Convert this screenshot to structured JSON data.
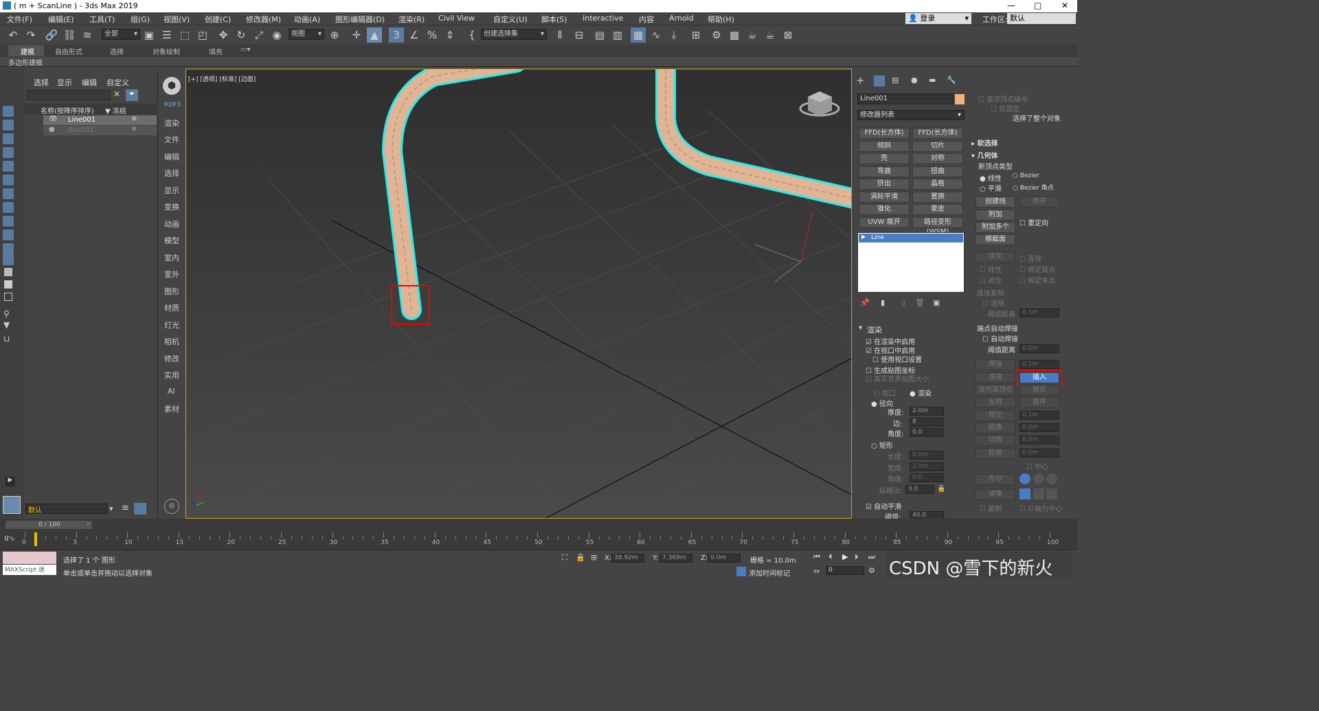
{
  "window": {
    "title": "( m + ScanLine ) - 3ds Max 2019",
    "controls": [
      "—",
      "□",
      "✕"
    ]
  },
  "menu": [
    "文件(F)",
    "编辑(E)",
    "工具(T)",
    "组(G)",
    "视图(V)",
    "创建(C)",
    "修改器(M)",
    "动画(A)",
    "图形编辑器(D)",
    "渲染(R)",
    "Civil View",
    "自定义(U)",
    "脚本(S)",
    "Interactive",
    "内容",
    "Arnold",
    "帮助(H)"
  ],
  "account": {
    "login": "登录",
    "workspace_label": "工作区:",
    "workspace_value": "默认"
  },
  "toolbar": {
    "selection_filter": "全部",
    "ref_coord": "视图",
    "named_selection": "创建选择集"
  },
  "ribbon": {
    "tabs": [
      "建模",
      "自由形式",
      "选择",
      "对象绘制",
      "填充"
    ],
    "active_tab": "建模",
    "sub": "多边形建模"
  },
  "scene_explorer": {
    "menu": [
      "选择",
      "显示",
      "编辑",
      "自定义"
    ],
    "column_name": "名称(按降序排序)",
    "column_freeze": "▼ 冻结",
    "rows": [
      {
        "name": "Line001",
        "selected": true
      },
      {
        "name": "Box001",
        "selected": false
      }
    ],
    "layer": "默认"
  },
  "command_strip": [
    "RDF3",
    "渲染",
    "文件",
    "编辑",
    "选择",
    "显示",
    "变换",
    "动画",
    "模型",
    "室内",
    "室外",
    "图形",
    "材质",
    "灯光",
    "相机",
    "修改",
    "实用",
    "AI",
    "素材"
  ],
  "viewport": {
    "label": "[+] [透视] [标准] [边面]"
  },
  "modify_panel": {
    "object_name": "Line001",
    "object_color": "#f2b27c",
    "modifier_list_label": "修改器列表",
    "modifier_buttons": [
      "FFD(长方体)",
      "FFD(长方体)",
      "倾斜",
      "切片",
      "壳",
      "对称",
      "弯曲",
      "扭曲",
      "挤出",
      "晶格",
      "涡轮平滑",
      "置换",
      "锥化",
      "蒙皮",
      "UVW 展开",
      "路径变形 (WSM)"
    ],
    "stack_item": "Line",
    "rendering": {
      "title": "渲染",
      "enable_render": "在渲染中启用",
      "enable_viewport": "在视口中启用",
      "use_viewport_settings": "使用视口设置",
      "gen_mapping": "生成贴图坐标",
      "real_world": "真实世界贴图大小",
      "viewport_radio": "视口",
      "render_radio": "渲染",
      "radial": "径向",
      "thickness_label": "厚度:",
      "thickness": "2.0m",
      "sides_label": "边:",
      "sides": "8",
      "angle_label": "角度:",
      "angle": "0.0",
      "rect": "矩形",
      "length_label": "长度:",
      "length": "6.0m",
      "width_label": "宽度:",
      "width": "2.0m",
      "angle2_label": "角度:",
      "angle2": "0.0",
      "aspect_label": "纵横比:",
      "aspect": "3.0",
      "auto_smooth": "自动平滑",
      "threshold_label": "阈值:",
      "threshold": "40.0"
    },
    "right_col": {
      "show_vertex_num": "显示顶点编号",
      "only_selected": "仅选定",
      "selected_whole": "选择了整个对象",
      "soft_sel": "软选择",
      "geometry": "几何体",
      "new_vertex_type": "新顶点类型",
      "linear": "线性",
      "bezier": "Bezier",
      "smooth": "平滑",
      "bezier_corner": "Bezier 角点",
      "create_line": "创建线",
      "break": "断开",
      "attach": "附加",
      "attach_multi": "附加多个",
      "reorient": "重定向",
      "cross_section": "横截面",
      "optimize": "优化",
      "connect": "连接",
      "linear2": "线性",
      "bind_first": "绑定首点",
      "close": "闭合",
      "bind_last": "绑定末点",
      "connect_copy": "连接复制",
      "connect2": "连接",
      "threshold_dist": "阈值距离",
      "threshold_dist_val": "0.1m",
      "endpoint_weld": "端点自动焊接",
      "auto_weld": "自动焊接",
      "threshold_dist2": "阈值距离",
      "threshold_dist2_val": "6.0m",
      "weld": "焊接",
      "weld_val": "0.1m",
      "connect3": "连接",
      "insert": "插入",
      "make_first": "设为首顶点",
      "fuse": "熔合",
      "reverse": "反转",
      "cycle": "循环",
      "intersect": "相交",
      "intersect_val": "0.1m",
      "fillet": "圆角",
      "fillet_val": "0.0m",
      "chamfer": "切角",
      "chamfer_val": "0.0m",
      "outline": "轮廓",
      "outline_val": "0.0m",
      "center": "中心",
      "boolean": "布尔",
      "mirror": "镜像",
      "copy": "复制",
      "about_pivot": "以轴为中心"
    }
  },
  "timeline": {
    "frame": "0 / 100",
    "ticks": [
      "0",
      "5",
      "10",
      "15",
      "20",
      "25",
      "30",
      "35",
      "40",
      "45",
      "50",
      "55",
      "60",
      "65",
      "70",
      "75",
      "80",
      "85",
      "90",
      "95",
      "100"
    ]
  },
  "status": {
    "maxscript": "MAXScript 迷",
    "line1": "选择了 1 个 图形",
    "line2": "单击或单击并拖动以选择对象",
    "x_label": "X:",
    "x": "38.92m",
    "y_label": "Y:",
    "y": "7.369m",
    "z_label": "Z:",
    "z": "0.0m",
    "grid": "栅格 = 10.0m",
    "add_time_tag": "添加时间标记",
    "frame_field": "0",
    "watermark": "CSDN @雪下的新火"
  }
}
